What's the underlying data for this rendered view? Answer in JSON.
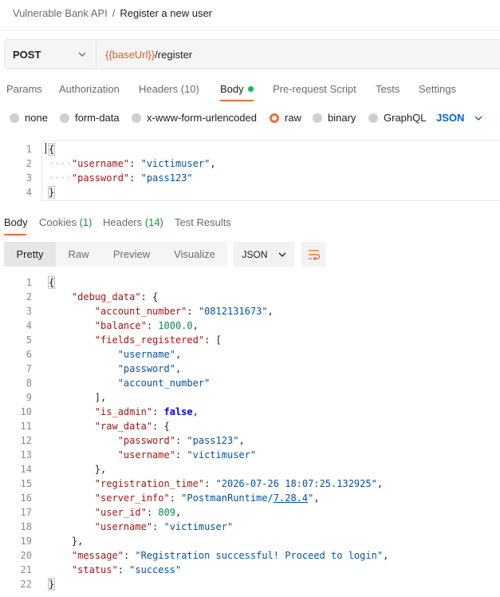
{
  "breadcrumb": {
    "collection": "Vulnerable Bank API",
    "separator": "/",
    "request": "Register a new user"
  },
  "request": {
    "method": "POST",
    "url_variable": "{{baseUrl}}",
    "url_path": "/register"
  },
  "request_tabs": [
    "Params",
    "Authorization",
    "Headers (10)",
    "Body",
    "Pre-request Script",
    "Tests",
    "Settings"
  ],
  "active_request_tab": "Body",
  "body_types": [
    "none",
    "form-data",
    "x-www-form-urlencoded",
    "raw",
    "binary",
    "GraphQL"
  ],
  "selected_body_type": "raw",
  "body_language": "JSON",
  "request_body": {
    "line_numbers": [
      "1",
      "2",
      "3",
      "4"
    ],
    "username_key": "\"username\"",
    "username_value": "\"victimuser\"",
    "password_key": "\"password\"",
    "password_value": "\"pass123\""
  },
  "response_tabs": {
    "body": "Body",
    "cookies": "Cookies",
    "cookies_count": "(1)",
    "headers": "Headers",
    "headers_count": "(14)",
    "test_results": "Test Results"
  },
  "view_modes": [
    "Pretty",
    "Raw",
    "Preview",
    "Visualize"
  ],
  "active_view_mode": "Pretty",
  "response_format": "JSON",
  "response_body": {
    "line_numbers": [
      "1",
      "2",
      "3",
      "4",
      "5",
      "6",
      "7",
      "8",
      "9",
      "10",
      "11",
      "12",
      "13",
      "14",
      "15",
      "16",
      "17",
      "18",
      "19",
      "20",
      "21",
      "22"
    ],
    "debug_data_key": "\"debug_data\"",
    "account_number_key": "\"account_number\"",
    "account_number_value": "\"0812131673\"",
    "balance_key": "\"balance\"",
    "balance_value": "1000.0",
    "fields_registered_key": "\"fields_registered\"",
    "fields_registered": [
      "\"username\"",
      "\"password\"",
      "\"account_number\""
    ],
    "is_admin_key": "\"is_admin\"",
    "is_admin_value": "false",
    "raw_data_key": "\"raw_data\"",
    "raw_password_key": "\"password\"",
    "raw_password_value": "\"pass123\"",
    "raw_username_key": "\"username\"",
    "raw_username_value": "\"victimuser\"",
    "registration_time_key": "\"registration_time\"",
    "registration_time_value": "\"2026-07-26 18:07:25.132925\"",
    "server_info_key": "\"server_info\"",
    "server_info_value_start": "\"PostmanRuntime/",
    "server_info_value_link": "7.28.4",
    "server_info_value_end": "\"",
    "user_id_key": "\"user_id\"",
    "user_id_value": "809",
    "username_key": "\"username\"",
    "username_value": "\"victimuser\"",
    "message_key": "\"message\"",
    "message_value": "\"Registration successful! Proceed to login\"",
    "status_key": "\"status\"",
    "status_value": "\"success\""
  },
  "colors": {
    "accent": "#f26b3a",
    "active_dot": "#0cbb52",
    "link_blue": "#0265d2",
    "json_key": "#a31515",
    "json_string": "#0451a5",
    "json_number": "#098658",
    "json_boolean": "#0000ff"
  }
}
